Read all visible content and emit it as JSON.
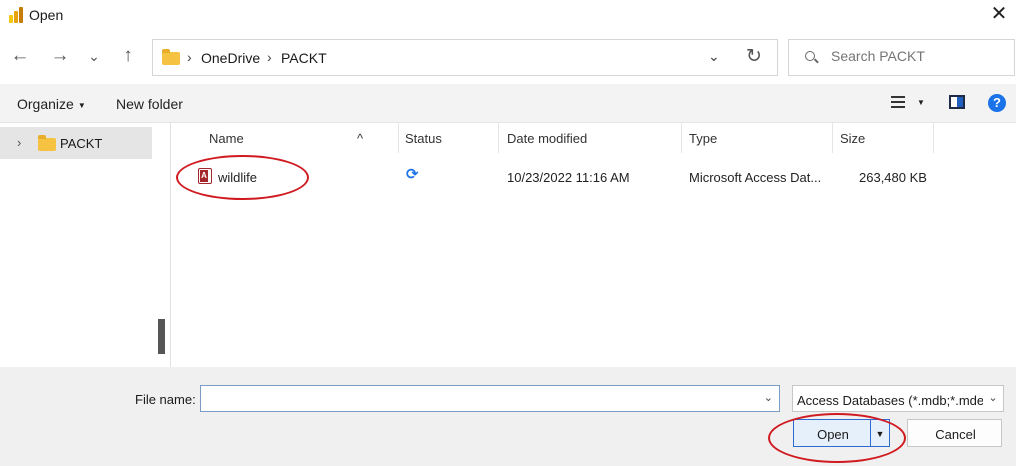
{
  "window": {
    "title": "Open",
    "close_glyph": "✕",
    "app_icon": "power-bi-icon",
    "icon_colors": [
      "#f2c811",
      "#e8a20a",
      "#c57d06"
    ]
  },
  "navigation": {
    "back_glyph": "←",
    "forward_glyph": "→",
    "recent_glyph": "⌄",
    "up_glyph": "↑",
    "breadcrumb": [
      "OneDrive",
      "PACKT"
    ],
    "separator": "›",
    "refresh_glyph": "↻",
    "chevron_glyph": "⌄"
  },
  "search": {
    "placeholder": "Search PACKT"
  },
  "toolbar": {
    "organize": "Organize",
    "new_folder": "New folder",
    "dropdown_glyph": "▼",
    "help_glyph": "?"
  },
  "sidebar": {
    "items": [
      {
        "label": "PACKT",
        "expander": "›",
        "icon": "folder-icon",
        "selected": true
      }
    ]
  },
  "columns": [
    "Name",
    "Status",
    "Date modified",
    "Type",
    "Size"
  ],
  "sort_glyph": "^",
  "files": [
    {
      "name": "wildlife",
      "icon": "access-database-icon",
      "status_glyph": "⟳",
      "status_icon": "sync-icon",
      "date_modified": "10/23/2022 11:16 AM",
      "type": "Microsoft Access Dat...",
      "size": "263,480 KB"
    }
  ],
  "bottom": {
    "file_name_label": "File name:",
    "file_name_value": "",
    "file_type": "Access Databases (*.mdb;*.mde",
    "dropdown_glyph": "⌄",
    "open_label": "Open",
    "open_drop_glyph": "▼",
    "cancel_label": "Cancel"
  },
  "colors": {
    "annotation": "#d01a20",
    "accent": "#1a73e8",
    "folder": "#f5c242",
    "access": "#a4262c"
  }
}
